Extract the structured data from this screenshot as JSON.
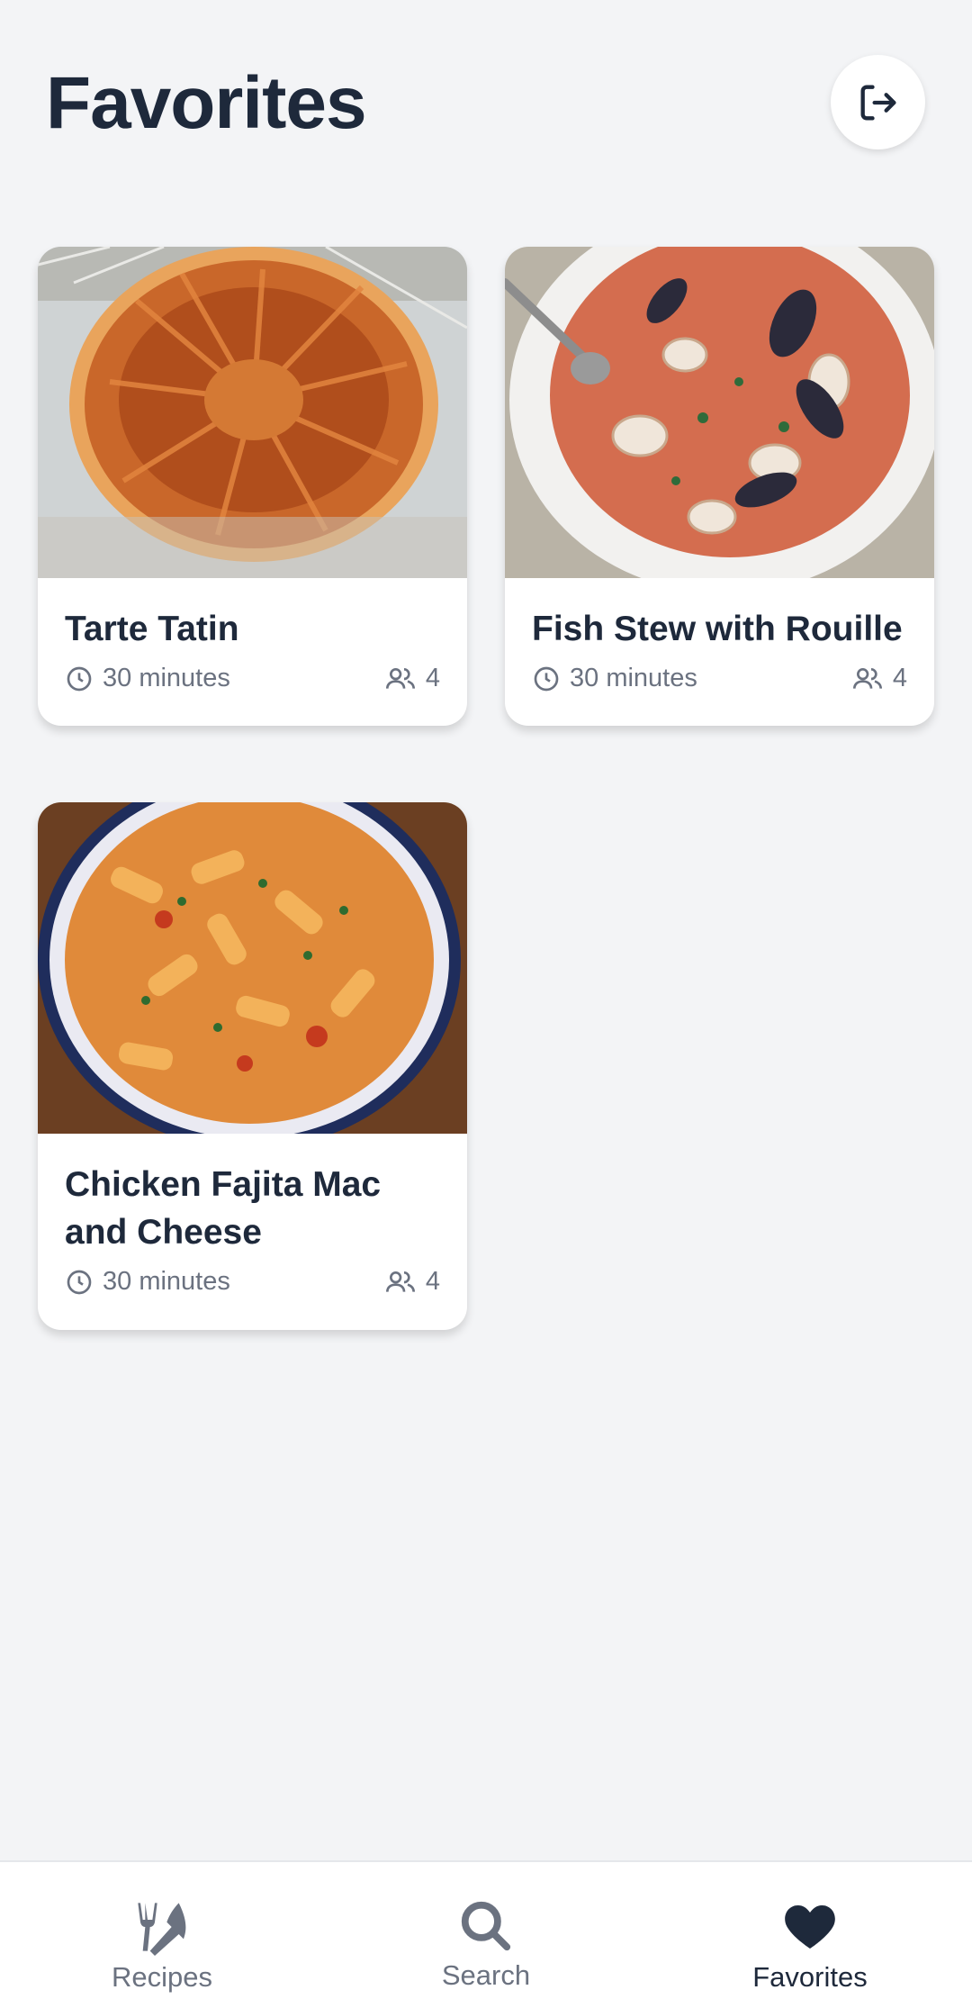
{
  "header": {
    "title": "Favorites",
    "logout_icon": "logout-icon"
  },
  "recipes": [
    {
      "title": "Tarte Tatin",
      "time": "30 minutes",
      "servings": "4",
      "image": "tarte-tatin-photo"
    },
    {
      "title": "Fish Stew with Rouille",
      "time": "30 minutes",
      "servings": "4",
      "image": "fish-stew-photo"
    },
    {
      "title": "Chicken Fajita Mac and Cheese",
      "time": "30 minutes",
      "servings": "4",
      "image": "pasta-photo"
    }
  ],
  "nav": {
    "items": [
      {
        "label": "Recipes",
        "icon": "utensils-icon"
      },
      {
        "label": "Search",
        "icon": "search-icon"
      },
      {
        "label": "Favorites",
        "icon": "heart-icon"
      }
    ],
    "active": "Favorites"
  },
  "colors": {
    "background": "#f3f4f6",
    "text": "#1e293b",
    "muted": "#6b7280",
    "active_nav": "#1e293b"
  }
}
